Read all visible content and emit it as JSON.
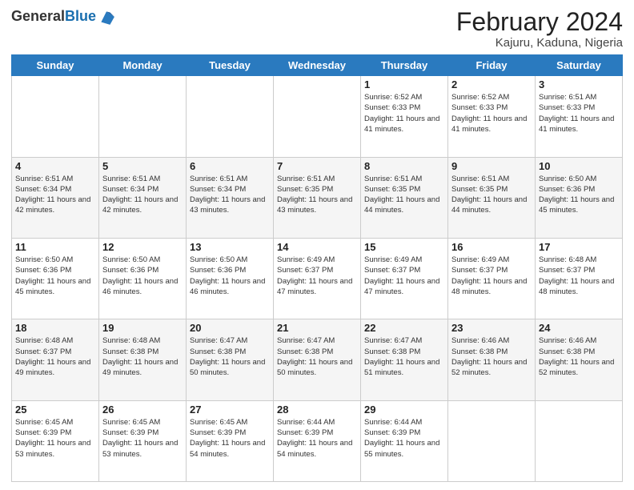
{
  "header": {
    "logo_general": "General",
    "logo_blue": "Blue",
    "month_title": "February 2024",
    "location": "Kajuru, Kaduna, Nigeria"
  },
  "days_of_week": [
    "Sunday",
    "Monday",
    "Tuesday",
    "Wednesday",
    "Thursday",
    "Friday",
    "Saturday"
  ],
  "weeks": [
    [
      {
        "day": "",
        "info": ""
      },
      {
        "day": "",
        "info": ""
      },
      {
        "day": "",
        "info": ""
      },
      {
        "day": "",
        "info": ""
      },
      {
        "day": "1",
        "info": "Sunrise: 6:52 AM\nSunset: 6:33 PM\nDaylight: 11 hours and 41 minutes."
      },
      {
        "day": "2",
        "info": "Sunrise: 6:52 AM\nSunset: 6:33 PM\nDaylight: 11 hours and 41 minutes."
      },
      {
        "day": "3",
        "info": "Sunrise: 6:51 AM\nSunset: 6:33 PM\nDaylight: 11 hours and 41 minutes."
      }
    ],
    [
      {
        "day": "4",
        "info": "Sunrise: 6:51 AM\nSunset: 6:34 PM\nDaylight: 11 hours and 42 minutes."
      },
      {
        "day": "5",
        "info": "Sunrise: 6:51 AM\nSunset: 6:34 PM\nDaylight: 11 hours and 42 minutes."
      },
      {
        "day": "6",
        "info": "Sunrise: 6:51 AM\nSunset: 6:34 PM\nDaylight: 11 hours and 43 minutes."
      },
      {
        "day": "7",
        "info": "Sunrise: 6:51 AM\nSunset: 6:35 PM\nDaylight: 11 hours and 43 minutes."
      },
      {
        "day": "8",
        "info": "Sunrise: 6:51 AM\nSunset: 6:35 PM\nDaylight: 11 hours and 44 minutes."
      },
      {
        "day": "9",
        "info": "Sunrise: 6:51 AM\nSunset: 6:35 PM\nDaylight: 11 hours and 44 minutes."
      },
      {
        "day": "10",
        "info": "Sunrise: 6:50 AM\nSunset: 6:36 PM\nDaylight: 11 hours and 45 minutes."
      }
    ],
    [
      {
        "day": "11",
        "info": "Sunrise: 6:50 AM\nSunset: 6:36 PM\nDaylight: 11 hours and 45 minutes."
      },
      {
        "day": "12",
        "info": "Sunrise: 6:50 AM\nSunset: 6:36 PM\nDaylight: 11 hours and 46 minutes."
      },
      {
        "day": "13",
        "info": "Sunrise: 6:50 AM\nSunset: 6:36 PM\nDaylight: 11 hours and 46 minutes."
      },
      {
        "day": "14",
        "info": "Sunrise: 6:49 AM\nSunset: 6:37 PM\nDaylight: 11 hours and 47 minutes."
      },
      {
        "day": "15",
        "info": "Sunrise: 6:49 AM\nSunset: 6:37 PM\nDaylight: 11 hours and 47 minutes."
      },
      {
        "day": "16",
        "info": "Sunrise: 6:49 AM\nSunset: 6:37 PM\nDaylight: 11 hours and 48 minutes."
      },
      {
        "day": "17",
        "info": "Sunrise: 6:48 AM\nSunset: 6:37 PM\nDaylight: 11 hours and 48 minutes."
      }
    ],
    [
      {
        "day": "18",
        "info": "Sunrise: 6:48 AM\nSunset: 6:37 PM\nDaylight: 11 hours and 49 minutes."
      },
      {
        "day": "19",
        "info": "Sunrise: 6:48 AM\nSunset: 6:38 PM\nDaylight: 11 hours and 49 minutes."
      },
      {
        "day": "20",
        "info": "Sunrise: 6:47 AM\nSunset: 6:38 PM\nDaylight: 11 hours and 50 minutes."
      },
      {
        "day": "21",
        "info": "Sunrise: 6:47 AM\nSunset: 6:38 PM\nDaylight: 11 hours and 50 minutes."
      },
      {
        "day": "22",
        "info": "Sunrise: 6:47 AM\nSunset: 6:38 PM\nDaylight: 11 hours and 51 minutes."
      },
      {
        "day": "23",
        "info": "Sunrise: 6:46 AM\nSunset: 6:38 PM\nDaylight: 11 hours and 52 minutes."
      },
      {
        "day": "24",
        "info": "Sunrise: 6:46 AM\nSunset: 6:38 PM\nDaylight: 11 hours and 52 minutes."
      }
    ],
    [
      {
        "day": "25",
        "info": "Sunrise: 6:45 AM\nSunset: 6:39 PM\nDaylight: 11 hours and 53 minutes."
      },
      {
        "day": "26",
        "info": "Sunrise: 6:45 AM\nSunset: 6:39 PM\nDaylight: 11 hours and 53 minutes."
      },
      {
        "day": "27",
        "info": "Sunrise: 6:45 AM\nSunset: 6:39 PM\nDaylight: 11 hours and 54 minutes."
      },
      {
        "day": "28",
        "info": "Sunrise: 6:44 AM\nSunset: 6:39 PM\nDaylight: 11 hours and 54 minutes."
      },
      {
        "day": "29",
        "info": "Sunrise: 6:44 AM\nSunset: 6:39 PM\nDaylight: 11 hours and 55 minutes."
      },
      {
        "day": "",
        "info": ""
      },
      {
        "day": "",
        "info": ""
      }
    ]
  ]
}
